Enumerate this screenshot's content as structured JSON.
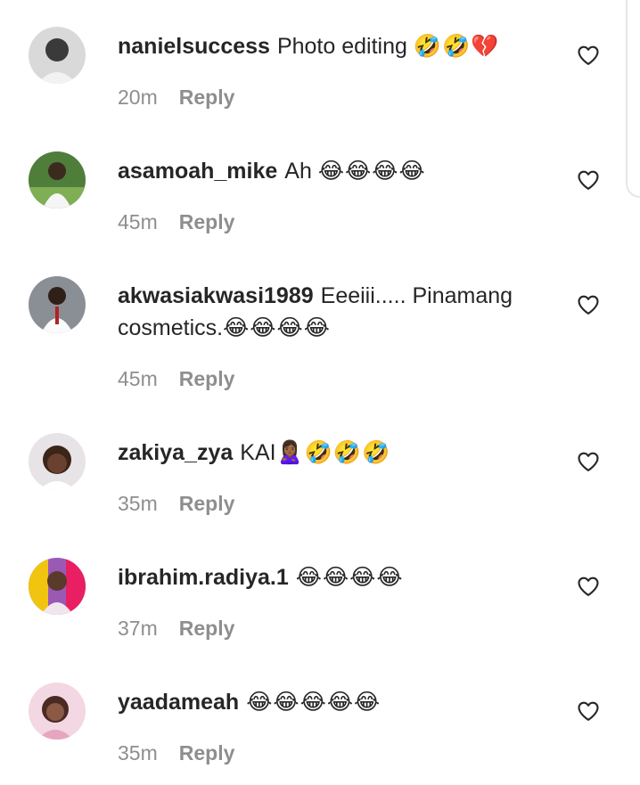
{
  "comments": [
    {
      "username": "nanielsuccess",
      "text": "Photo editing ",
      "emoji": "🤣🤣💔",
      "time": "20m",
      "reply_label": "Reply"
    },
    {
      "username": "asamoah_mike",
      "text": "Ah ",
      "emoji": "😂😂😂😂",
      "time": "45m",
      "reply_label": "Reply"
    },
    {
      "username": "akwasiakwasi1989",
      "text": "Eeeiii..... Pinamang cosmetics.",
      "emoji": "😂😂😂😂",
      "time": "45m",
      "reply_label": "Reply"
    },
    {
      "username": "zakiya_zya",
      "text": "KAI",
      "emoji": "🙎🏾‍♀️🤣🤣🤣",
      "time": "35m",
      "reply_label": "Reply"
    },
    {
      "username": "ibrahim.radiya.1",
      "text": "",
      "emoji": "😂😂😂😂",
      "time": "37m",
      "reply_label": "Reply"
    },
    {
      "username": "yaadameah",
      "text": "",
      "emoji": "😂😂😂😂😂",
      "time": "35m",
      "reply_label": "Reply"
    }
  ],
  "icons": {
    "like": "heart-outline-icon"
  },
  "colors": {
    "text": "#262626",
    "secondary_text": "#8e8e8e",
    "background": "#ffffff"
  }
}
